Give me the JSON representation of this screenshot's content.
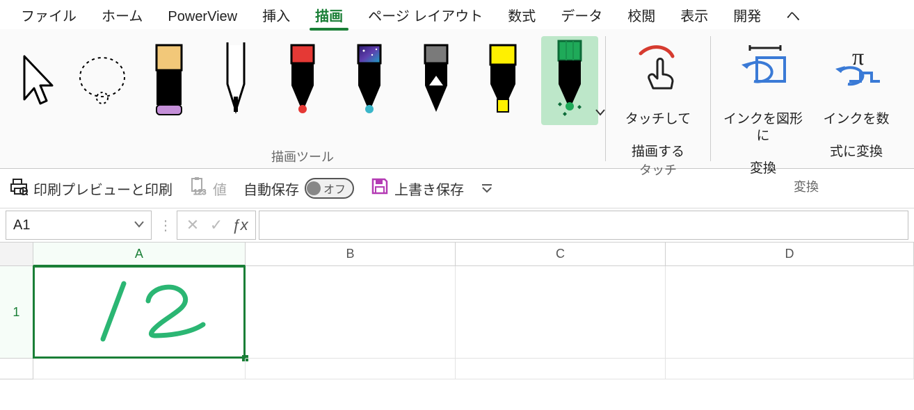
{
  "tabs": {
    "file": "ファイル",
    "home": "ホーム",
    "powerview": "PowerView",
    "insert": "挿入",
    "draw": "描画",
    "page_layout": "ページ レイアウト",
    "formulas": "数式",
    "data": "データ",
    "review": "校閲",
    "view": "表示",
    "developer": "開発",
    "more": "ヘ"
  },
  "active_tab": "draw",
  "ribbon": {
    "drawing_tools": {
      "label": "描画ツール"
    },
    "touch": {
      "label": "タッチ",
      "touch_draw_line1": "タッチして",
      "touch_draw_line2": "描画する"
    },
    "convert": {
      "label": "変換",
      "shape_line1": "インクを図形に",
      "shape_line2": "変換",
      "math_line1": "インクを数",
      "math_line2": "式に変換"
    }
  },
  "qat": {
    "print": "印刷プレビューと印刷",
    "value": "値",
    "autosave_label": "自動保存",
    "autosave_state": "オフ",
    "save": "上書き保存"
  },
  "namebox": {
    "value": "A1"
  },
  "columns": {
    "A": "A",
    "B": "B",
    "C": "C",
    "D": "D"
  },
  "rows": {
    "1": "1"
  },
  "ink_text": "12"
}
